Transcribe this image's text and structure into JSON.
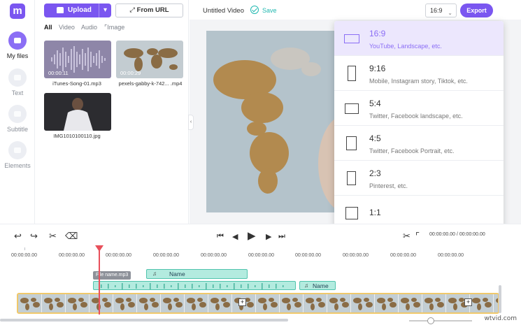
{
  "app": {
    "logo_letter": "m",
    "project_title": "Untitled Video",
    "save_label": "Save"
  },
  "sidebar": {
    "items": [
      {
        "label": "My files",
        "icon": "folder-icon",
        "active": true
      },
      {
        "label": "Text",
        "icon": "text-icon",
        "active": false
      },
      {
        "label": "Subtitle",
        "icon": "subtitle-icon",
        "active": false
      },
      {
        "label": "Elements",
        "icon": "elements-icon",
        "active": false
      }
    ]
  },
  "media": {
    "upload_label": "Upload",
    "url_label": "From URL",
    "tabs": [
      "All",
      "Video",
      "Audio",
      "Image"
    ],
    "items": [
      {
        "name": "iTunes-Song-01.mp3",
        "duration": "00:00:11"
      },
      {
        "name": "pexels-gabby-k-742... .mp4",
        "duration": "00:00:29"
      },
      {
        "name": "IMG1010100110.jpg",
        "duration": ""
      }
    ]
  },
  "toolbar": {
    "ratio_value": "16:9",
    "export_label": "Export"
  },
  "ratio_menu": {
    "options": [
      {
        "name": "16:9",
        "desc": "YouTube, Landscape, etc.",
        "selected": true
      },
      {
        "name": "9:16",
        "desc": "Mobile, Instagram story, Tiktok, etc.",
        "selected": false
      },
      {
        "name": "5:4",
        "desc": "Twitter, Facebook landscape, etc.",
        "selected": false
      },
      {
        "name": "4:5",
        "desc": "Twitter, Facebook Portrait, etc.",
        "selected": false
      },
      {
        "name": "2:3",
        "desc": "Pinterest, etc.",
        "selected": false
      },
      {
        "name": "1:1",
        "desc": "",
        "selected": false
      }
    ]
  },
  "timeline": {
    "timecode": "00:00:00.00 / 00:00:00.00",
    "ruler_labels": [
      "00:00:00.00",
      "00:00:00.00",
      "00:00:00.00",
      "00:00:00.00",
      "00:00:00.00",
      "00:00:00.00",
      "00:00:00.00",
      "00:00:00.00",
      "00:00:00.00",
      "00:00:00.00"
    ],
    "file_tag": "File name.mp3",
    "audio_clips": [
      {
        "label": "Name"
      },
      {
        "label": "Name"
      }
    ]
  },
  "watermark": "wtvid.com",
  "colors": {
    "accent": "#7a56f0",
    "teal": "#20b8b0",
    "playhead": "#e8505b",
    "clip": "#b3ebdf"
  }
}
